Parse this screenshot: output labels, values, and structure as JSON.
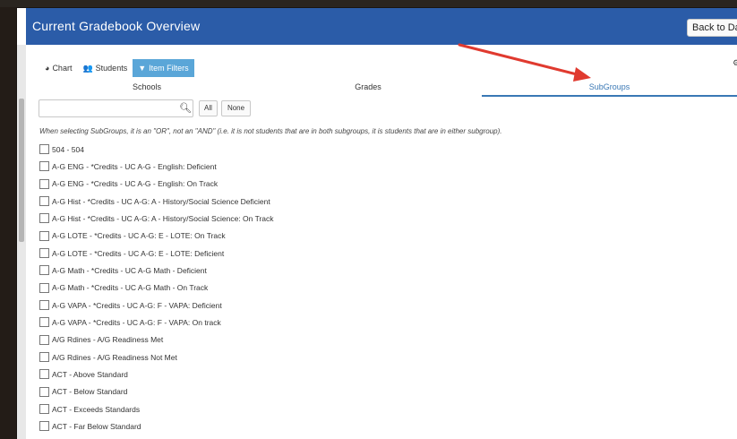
{
  "page": {
    "title": "Current Gradebook Overview",
    "back_button": "Back to Das"
  },
  "view_tabs": [
    {
      "label": "Chart",
      "icon": "pie-chart-icon"
    },
    {
      "label": "Students",
      "icon": "users-icon"
    },
    {
      "label": "Item Filters",
      "icon": "filter-icon",
      "active": true
    }
  ],
  "filter_tabs": {
    "schools": "Schools",
    "grades": "Grades",
    "subgroups": "SubGroups",
    "active": "SubGroups"
  },
  "search": {
    "value": "",
    "placeholder": ""
  },
  "buttons": {
    "all": "All",
    "none": "None"
  },
  "note": "When selecting SubGroups, it is an \"OR\", not an \"AND\" (i.e. it is not students that are in both subgroups, it is students that are in either subgroup).",
  "subgroups": [
    "504 - 504",
    "A-G ENG - *Credits - UC A-G - English: Deficient",
    "A-G ENG - *Credits - UC A-G - English: On Track",
    "A-G Hist - *Credits - UC A-G: A - History/Social Science Deficient",
    "A-G Hist - *Credits - UC A-G: A - History/Social Science: On Track",
    "A-G LOTE - *Credits - UC A-G: E - LOTE: On Track",
    "A-G LOTE - *Credits - UC A-G: E - LOTE: Deficient",
    "A-G Math - *Credits - UC A-G Math - Deficient",
    "A-G Math - *Credits - UC A-G Math - On Track",
    "A-G VAPA - *Credits - UC A-G: F - VAPA: Deficient",
    "A-G VAPA - *Credits - UC A-G: F - VAPA: On track",
    "A/G Rdines - A/G Readiness Met",
    "A/G Rdines - A/G Readiness Not Met",
    "ACT - Above Standard",
    "ACT - Below Standard",
    "ACT - Exceeds Standards",
    "ACT - Far Below Standard"
  ],
  "colors": {
    "header": "#2b5ca8",
    "active_tab": "#5aa6d8",
    "subgroups_accent": "#3a78b5",
    "annotation_arrow": "#e03a2f"
  }
}
